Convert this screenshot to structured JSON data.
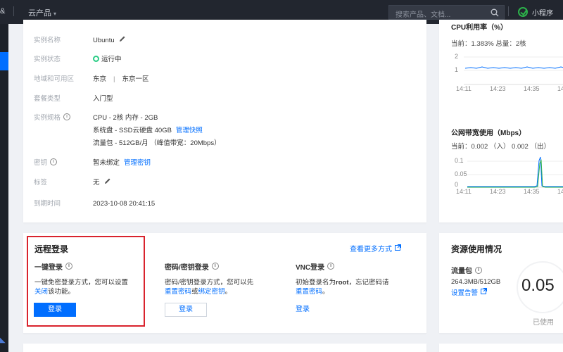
{
  "topbar": {
    "left_fragment": "&",
    "products_label": "云产品",
    "search_placeholder": "搜索产品、文档...",
    "mini_program": "小程序"
  },
  "instance": {
    "rows": [
      {
        "label": "实例名称",
        "value": "Ubuntu"
      },
      {
        "label": "实例状态",
        "value": "运行中"
      },
      {
        "label": "地域和可用区",
        "region": "东京",
        "sep": "|",
        "zone": "东京一区"
      },
      {
        "label": "套餐类型",
        "value": "入门型"
      },
      {
        "label": "实例规格",
        "lines": [
          "CPU - 2核 内存 - 2GB",
          "系统盘 - SSD云硬盘 40GB",
          "流量包 - 512GB/月 （峰值带宽：20Mbps）"
        ],
        "link": "管理快照"
      },
      {
        "label": "密钥",
        "value": "暂未绑定",
        "link": "管理密钥"
      },
      {
        "label": "标签",
        "value": "无"
      },
      {
        "label": "到期时间",
        "value": "2023-10-08 20:41:15"
      }
    ]
  },
  "cpu": {
    "title": "CPU利用率（%）",
    "current": "当前：1.383% 总量：2核",
    "y_ticks": [
      "2",
      "1"
    ],
    "x_ticks": [
      "14:11",
      "14:23",
      "14:35",
      "14"
    ]
  },
  "network": {
    "title": "公网带宽使用（Mbps）",
    "current": "当前：0.002 （入） 0.002 （出）",
    "y_ticks": [
      "0.1",
      "0.05",
      "0"
    ],
    "x_ticks": [
      "14:11",
      "14:23",
      "14:35",
      "14"
    ]
  },
  "remote": {
    "title": "远程登录",
    "more_link": "查看更多方式",
    "one_click": {
      "heading": "一键登录",
      "desc_1": "一键免密登录方式，您可以设置",
      "desc_link": "关闭",
      "desc_2": "该功能。",
      "button": "登录"
    },
    "password": {
      "heading": "密码/密钥登录",
      "desc_1": "密码/密钥登录方式，您可以先",
      "link_1": "重置密码",
      "mid": "或",
      "link_2": "绑定密钥",
      "end": "。",
      "button": "登录"
    },
    "vnc": {
      "heading": "VNC登录",
      "desc_1": "初始登录名为",
      "bold": "root",
      "desc_2": "，忘记密码请",
      "link": "重置密码",
      "end": "。",
      "button": "登录"
    }
  },
  "resource": {
    "title": "资源使用情况",
    "flow_label": "流量包",
    "used": "264.3MB/512GB",
    "alert_link": "设置告警",
    "percent": "0.05",
    "used_label": "已使用"
  },
  "colors": {
    "accent": "#006eff",
    "running": "#29cc85",
    "highlight": "#d9232d",
    "topbar": "#22262f"
  }
}
